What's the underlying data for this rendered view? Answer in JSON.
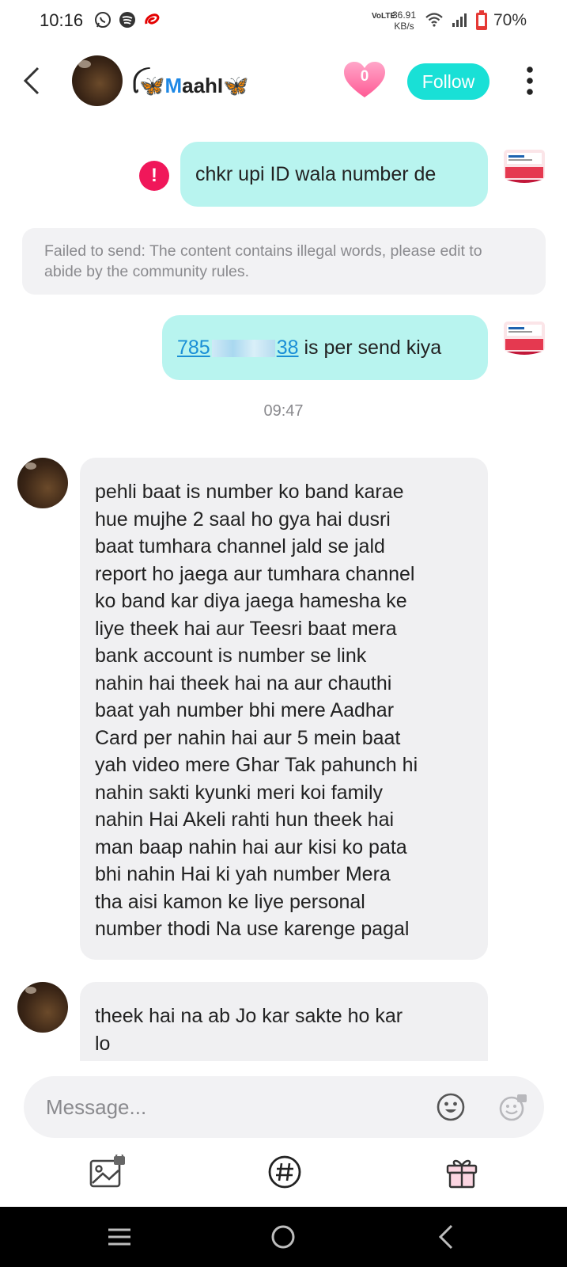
{
  "status_bar": {
    "time": "10:16",
    "network_label": "VoLTE",
    "speed_value": "36.91",
    "speed_unit": "KB/s",
    "battery": "70%"
  },
  "header": {
    "username_prefix": "ꪶ🦋",
    "username_m": "M",
    "username_rest": "aahI🦋",
    "heart_count": "0",
    "follow_label": "Follow"
  },
  "messages": {
    "m1": {
      "text": "chkr upi ID wala number de",
      "error_icon": "!"
    },
    "notice": "Failed to send: The content contains illegal words, please edit to abide by the community rules.",
    "m2": {
      "num_start": "785",
      "num_end": "38",
      "rest": " is per send kiya"
    },
    "timestamp": "09:47",
    "m3_lines": [
      "pehli baat is number ko band karae",
      "hue mujhe 2 saal ho gya hai dusri",
      "baat tumhara channel jald se jald",
      "report ho jaega aur tumhara channel",
      "ko band kar diya jaega hamesha ke",
      "liye theek hai aur Teesri baat mera",
      "bank account is number se link",
      "nahin hai theek hai na aur chauthi",
      "baat yah number bhi mere Aadhar",
      "Card per nahin hai aur 5 mein baat",
      "yah video mere Ghar Tak pahunch hi",
      "nahin sakti kyunki meri koi family",
      "nahin Hai Akeli rahti hun theek hai",
      "man baap nahin hai aur kisi ko pata",
      "bhi nahin Hai ki yah number Mera",
      "tha aisi kamon ke liye personal",
      "number thodi Na use karenge pagal"
    ],
    "m4_lines": [
      "theek hai na ab Jo kar sakte ho kar",
      "lo"
    ]
  },
  "composer": {
    "placeholder": "Message..."
  },
  "colors": {
    "accent": "#19e0d6",
    "bubble_out": "#b8f4ef",
    "bubble_in": "#f0f0f2",
    "error": "#f0175a",
    "link": "#1a8fd6"
  },
  "icons": [
    "back-icon",
    "heart-icon",
    "more-icon",
    "error-icon",
    "emoji-icon",
    "sticker-icon",
    "image-icon",
    "hashtag-icon",
    "gift-icon",
    "nav-menu-icon",
    "nav-home-icon",
    "nav-back-icon"
  ]
}
